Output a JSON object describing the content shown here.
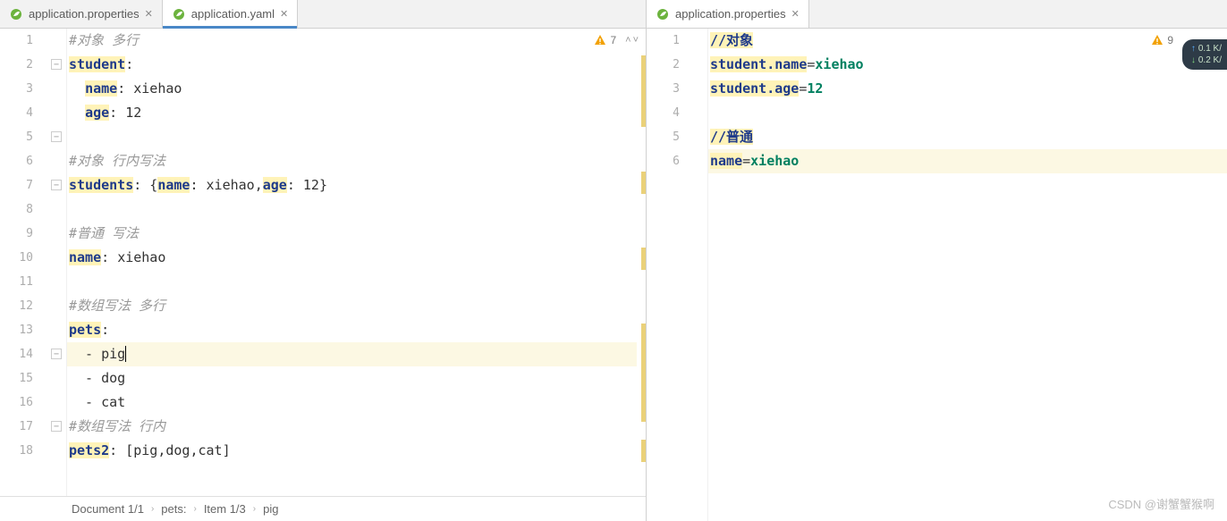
{
  "tabs_left": [
    {
      "label": "application.properties",
      "active": false
    },
    {
      "label": "application.yaml",
      "active": true
    }
  ],
  "tabs_right": [
    {
      "label": "application.properties",
      "active": true
    }
  ],
  "left_warning": "7",
  "right_warning": "9",
  "perf": {
    "up": "0.1 K/",
    "down": "0.2 K/"
  },
  "left_lines": {
    "1": {
      "type": "comment",
      "text": "#对象 多行"
    },
    "2": {
      "type": "kv",
      "key": "student",
      "colon": ":"
    },
    "3": {
      "type": "kv_indent",
      "indent": "  ",
      "key": "name",
      "colon": ": ",
      "val": "xiehao"
    },
    "4": {
      "type": "kv_indent",
      "indent": "  ",
      "key": "age",
      "colon": ": ",
      "val": "12"
    },
    "5": {
      "type": "blank"
    },
    "6": {
      "type": "comment",
      "text": "#对象 行内写法"
    },
    "7": {
      "type": "inline",
      "key": "students",
      "pre": ": {",
      "k1": "name",
      "v1": ": xiehao,",
      "k2": "age",
      "v2": ": 12}",
      "post": ""
    },
    "8": {
      "type": "blank"
    },
    "9": {
      "type": "comment",
      "text": "#普通 写法"
    },
    "10": {
      "type": "kv",
      "key": "name",
      "colon": ": ",
      "val": "xiehao"
    },
    "11": {
      "type": "blank"
    },
    "12": {
      "type": "comment",
      "text": "#数组写法 多行"
    },
    "13": {
      "type": "kv",
      "key": "pets",
      "colon": ":"
    },
    "14": {
      "type": "list",
      "text": "  - pig",
      "current": true
    },
    "15": {
      "type": "list",
      "text": "  - dog"
    },
    "16": {
      "type": "list",
      "text": "  - cat"
    },
    "17": {
      "type": "comment",
      "text": "#数组写法 行内"
    },
    "18": {
      "type": "kv",
      "key": "pets2",
      "colon": ": ",
      "val": "[pig,dog,cat]"
    }
  },
  "right_lines": {
    "1": {
      "type": "pcomment",
      "text": "//对象"
    },
    "2": {
      "type": "pkv",
      "key": "student.name",
      "val": "xiehao"
    },
    "3": {
      "type": "pkv",
      "key": "student.age",
      "val": "12"
    },
    "4": {
      "type": "blank"
    },
    "5": {
      "type": "pcomment",
      "text": "//普通"
    },
    "6": {
      "type": "pkv",
      "key": "name",
      "val": "xiehao",
      "current": true
    }
  },
  "breadcrumb": [
    "Document 1/1",
    "pets:",
    "Item 1/3",
    "pig"
  ],
  "watermark": "CSDN @谢蟹蟹猴啊"
}
